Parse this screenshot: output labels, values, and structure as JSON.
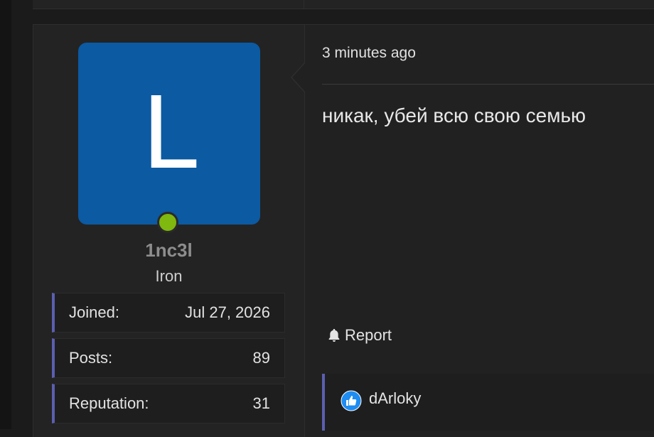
{
  "post": {
    "time_ago": "3 minutes ago",
    "message": "никак, убей всю свою семью",
    "report_label": "Report",
    "reaction_user": "dArloky"
  },
  "author": {
    "avatar_letter": "L",
    "username": "1nc3l",
    "rank": "Iron",
    "online": true,
    "avatar_color": "#0b5aa2",
    "status_color": "#7fb80e",
    "stats": [
      {
        "label": "Joined:",
        "value": "Jul 27, 2026"
      },
      {
        "label": "Posts:",
        "value": "89"
      },
      {
        "label": "Reputation:",
        "value": "31"
      }
    ]
  },
  "icons": {
    "report": "bell-icon",
    "reaction": "like-icon",
    "online": "online-status-icon"
  },
  "colors": {
    "accent": "#5b5fb0",
    "background": "#1b1b1b",
    "panel": "#232323"
  }
}
